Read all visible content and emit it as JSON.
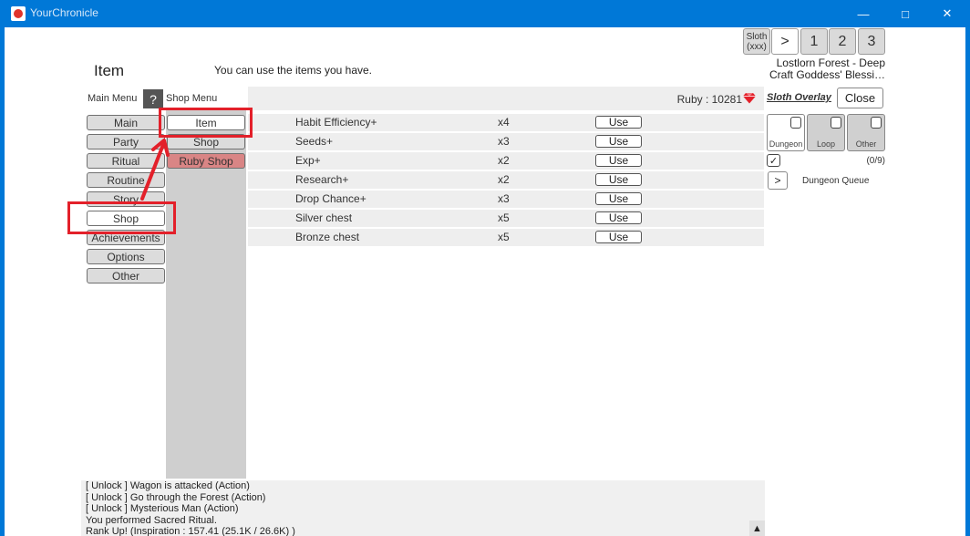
{
  "window": {
    "title": "YourChronicle",
    "minimize_glyph": "—",
    "maximize_glyph": "□",
    "close_glyph": "✕"
  },
  "header": {
    "title": "Item",
    "description": "You can use the items you have."
  },
  "top_right": {
    "sloth_label": "Sloth",
    "sloth_sub": "(xxx)",
    "next_label": ">",
    "page1": "1",
    "page2": "2",
    "page3": "3",
    "area_line1": "Lostlorn Forest - Deep",
    "area_line2": "Craft Goddess' Blessi…"
  },
  "main_menu": {
    "label": "Main Menu",
    "help": "?",
    "items": [
      "Main",
      "Party",
      "Ritual",
      "Routine",
      "Story",
      "Shop",
      "Achievements",
      "Options",
      "Other"
    ]
  },
  "shop_menu": {
    "label": "Shop Menu",
    "items": [
      "Item",
      "Shop",
      "Ruby Shop"
    ]
  },
  "ruby": {
    "label": "Ruby : 10281"
  },
  "items": [
    {
      "name": "Habit Efficiency+",
      "qty": "x4",
      "action": "Use"
    },
    {
      "name": "Seeds+",
      "qty": "x3",
      "action": "Use"
    },
    {
      "name": "Exp+",
      "qty": "x2",
      "action": "Use"
    },
    {
      "name": "Research+",
      "qty": "x2",
      "action": "Use"
    },
    {
      "name": "Drop Chance+",
      "qty": "x3",
      "action": "Use"
    },
    {
      "name": "Silver chest",
      "qty": "x5",
      "action": "Use"
    },
    {
      "name": "Bronze chest",
      "qty": "x5",
      "action": "Use"
    }
  ],
  "sloth_panel": {
    "overlay_label": "Sloth Overlay",
    "close_label": "Close",
    "filters": [
      "Dungeon",
      "Loop",
      "Other"
    ],
    "count": "(0/9)",
    "queue_button": ">",
    "queue_label": "Dungeon Queue",
    "check_glyph": "✓"
  },
  "log": {
    "lines": [
      "[ Unlock ] Wagon is attacked (Action)",
      "[ Unlock ] Go through the Forest (Action)",
      "[ Unlock ] Mysterious Man (Action)",
      "You performed Sacred Ritual.",
      "Rank Up! (Inspiration : 157.41 (25.1K / 26.6K) )"
    ],
    "scroll_glyph": "▲"
  },
  "colors": {
    "titlebar": "#0078d7",
    "highlight": "#e3202a",
    "ruby_shop": "#d98585",
    "ruby_gem": "#e3202a"
  }
}
